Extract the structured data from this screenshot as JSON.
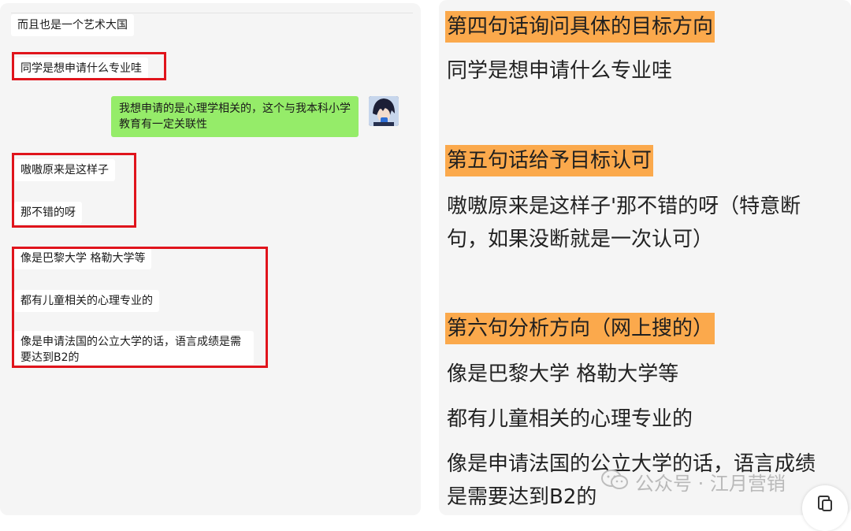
{
  "chat": {
    "msg_art_country": "而且也是一个艺术大国",
    "msg_ask_major": "同学是想申请什么专业哇",
    "msg_user_reply": "我想申请的是心理学相关的，这个与我本科小学教育有一定关联性",
    "msg_oh_i_see": "嗷嗷原来是这样子",
    "msg_not_bad": "那不错的呀",
    "msg_paris": "像是巴黎大学 格勒大学等",
    "msg_child_psych": "都有儿童相关的心理专业的",
    "msg_language": "像是申请法国的公立大学的话，语言成绩是需要达到B2的"
  },
  "notes": {
    "h4": "第四句话询问具体的目标方向",
    "p4": "同学是想申请什么专业哇",
    "h5": "第五句话给予目标认可",
    "p5_line1": "嗷嗷原来是这样子'那不错的呀（特意断",
    "p5_line2": "句，如果没断就是一次认可）",
    "h6": "第六句分析方向（网上搜的）",
    "p6_a": "像是巴黎大学 格勒大学等",
    "p6_b": "都有儿童相关的心理专业的",
    "p6_c_line1": "像是申请法国的公立大学的话，语言成绩",
    "p6_c_line2": "是需要达到B2的"
  },
  "watermark": {
    "text": "公众号 · 江月营销",
    "icon": "wechat-icon"
  },
  "colors": {
    "highlight": "#fba94c",
    "user_bubble": "#95ec69",
    "red_box": "#e0141c"
  },
  "icons": {
    "fab": "copy-icon"
  }
}
